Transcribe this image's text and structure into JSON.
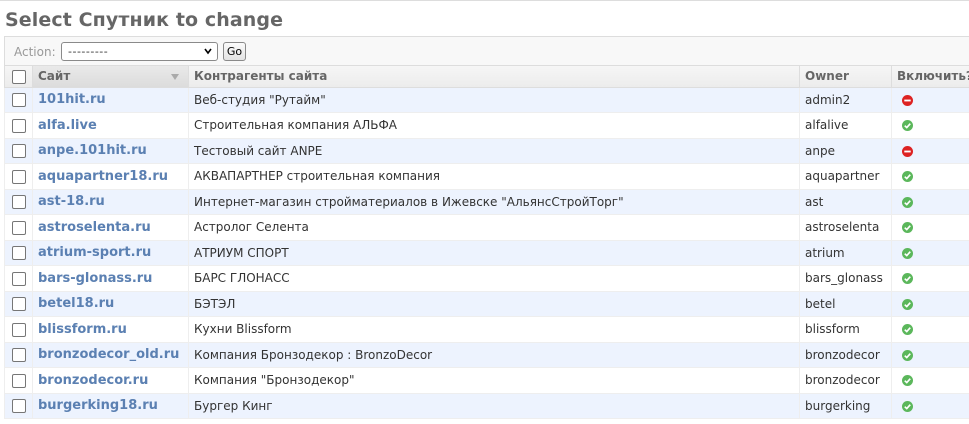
{
  "page": {
    "title": "Select Спутник to change"
  },
  "actions": {
    "label": "Action:",
    "selected": "---------",
    "go_label": "Go"
  },
  "table": {
    "columns": [
      "Сайт",
      "Контрагенты сайта",
      "Owner",
      "Включить?"
    ],
    "sorted_column": "Сайт",
    "rows": [
      {
        "site": "101hit.ru",
        "contractor": "Веб-студия \"Рутайм\"",
        "owner": "admin2",
        "enabled": false
      },
      {
        "site": "alfa.live",
        "contractor": "Строительная компания АЛЬФА",
        "owner": "alfalive",
        "enabled": true
      },
      {
        "site": "anpe.101hit.ru",
        "contractor": "Тестовый сайт ANPE",
        "owner": "anpe",
        "enabled": false
      },
      {
        "site": "aquapartner18.ru",
        "contractor": "АКВАПАРТНЕР строительная компания",
        "owner": "aquapartner",
        "enabled": true
      },
      {
        "site": "ast-18.ru",
        "contractor": "Интернет-магазин стройматериалов в Ижевске \"АльянсСтройТорг\"",
        "owner": "ast",
        "enabled": true
      },
      {
        "site": "astroselenta.ru",
        "contractor": "Астролог Селента",
        "owner": "astroselenta",
        "enabled": true
      },
      {
        "site": "atrium-sport.ru",
        "contractor": "АТРИУМ СПОРТ",
        "owner": "atrium",
        "enabled": true
      },
      {
        "site": "bars-glonass.ru",
        "contractor": "БАРС ГЛОНАСС",
        "owner": "bars_glonass",
        "enabled": true
      },
      {
        "site": "betel18.ru",
        "contractor": "БЭТЭЛ",
        "owner": "betel",
        "enabled": true
      },
      {
        "site": "blissform.ru",
        "contractor": "Кухни Blissform",
        "owner": "blissform",
        "enabled": true
      },
      {
        "site": "bronzodecor_old.ru",
        "contractor": "Компания Бронзодекор : BronzoDecor",
        "owner": "bronzodecor",
        "enabled": true
      },
      {
        "site": "bronzodecor.ru",
        "contractor": "Компания \"Бронзодекор\"",
        "owner": "bronzodecor",
        "enabled": true
      },
      {
        "site": "burgerking18.ru",
        "contractor": "Бургер Кинг",
        "owner": "burgerking",
        "enabled": true
      }
    ]
  },
  "colors": {
    "link": "#5b80b2",
    "row_alt": "#edf3fe",
    "yes": "#5bb75b",
    "no": "#dd2222"
  },
  "icons": {
    "yes": "check-circle-icon",
    "no": "minus-circle-icon",
    "sort": "sort-triangle-icon"
  }
}
